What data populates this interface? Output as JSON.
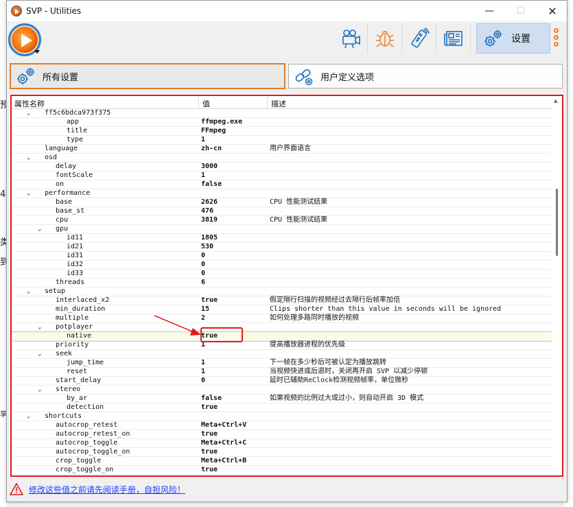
{
  "window": {
    "title": "SVP - Utilities"
  },
  "toolbar": {
    "settings_label": "设置"
  },
  "tabs": {
    "all_settings": "所有设置",
    "user_options": "用户定义选项"
  },
  "grid": {
    "headers": {
      "name": "属性名称",
      "value": "值",
      "description": "描述"
    },
    "rows": [
      {
        "name": "ff5c6bdca973f375",
        "value": "",
        "desc": ""
      },
      {
        "name": "app",
        "value": "ffmpeg.exe",
        "desc": ""
      },
      {
        "name": "title",
        "value": "FFmpeg",
        "desc": ""
      },
      {
        "name": "type",
        "value": "1",
        "desc": ""
      },
      {
        "name": "language",
        "value": "zh-cn",
        "desc": "用户界面语言"
      },
      {
        "name": "osd",
        "value": "",
        "desc": ""
      },
      {
        "name": "delay",
        "value": "3000",
        "desc": ""
      },
      {
        "name": "fontScale",
        "value": "1",
        "desc": ""
      },
      {
        "name": "on",
        "value": "false",
        "desc": ""
      },
      {
        "name": "performance",
        "value": "",
        "desc": ""
      },
      {
        "name": "base",
        "value": "2626",
        "desc": "CPU 性能测试结果"
      },
      {
        "name": "base_st",
        "value": "476",
        "desc": ""
      },
      {
        "name": "cpu",
        "value": "3819",
        "desc": "CPU 性能测试结果"
      },
      {
        "name": "gpu",
        "value": "",
        "desc": ""
      },
      {
        "name": "id11",
        "value": "1805",
        "desc": ""
      },
      {
        "name": "id21",
        "value": "530",
        "desc": ""
      },
      {
        "name": "id31",
        "value": "0",
        "desc": ""
      },
      {
        "name": "id32",
        "value": "0",
        "desc": ""
      },
      {
        "name": "id33",
        "value": "0",
        "desc": ""
      },
      {
        "name": "threads",
        "value": "6",
        "desc": ""
      },
      {
        "name": "setup",
        "value": "",
        "desc": ""
      },
      {
        "name": "interlaced_x2",
        "value": "true",
        "desc": "假定隔行扫描的视频经过去隔行后帧率加倍"
      },
      {
        "name": "min_duration",
        "value": "15",
        "desc": "Clips shorter than this value in seconds will be ignored"
      },
      {
        "name": "multiple",
        "value": "2",
        "desc": "如何处理多路同时播放的视频"
      },
      {
        "name": "potplayer",
        "value": "",
        "desc": ""
      },
      {
        "name": "native",
        "value": "true",
        "desc": ""
      },
      {
        "name": "priority",
        "value": "1",
        "desc": "提高播放器进程的优先级"
      },
      {
        "name": "seek",
        "value": "",
        "desc": ""
      },
      {
        "name": "jump_time",
        "value": "1",
        "desc": "下一帧在多少秒后可被认定为播放跳转"
      },
      {
        "name": "reset",
        "value": "1",
        "desc": "当视频快进或后退时，关闭再开启 SVP 以减少停顿"
      },
      {
        "name": "start_delay",
        "value": "0",
        "desc": "延时已辅助ReClock检测视频帧率，单位微秒"
      },
      {
        "name": "stereo",
        "value": "",
        "desc": ""
      },
      {
        "name": "by_ar",
        "value": "false",
        "desc": "如果视频的比例过大或过小，则自动开启 3D 模式"
      },
      {
        "name": "detection",
        "value": "true",
        "desc": ""
      },
      {
        "name": "shortcuts",
        "value": "",
        "desc": ""
      },
      {
        "name": "autocrop_retest",
        "value": "Meta+Ctrl+V",
        "desc": ""
      },
      {
        "name": "autocrop_retest_on",
        "value": "true",
        "desc": ""
      },
      {
        "name": "autocrop_toggle",
        "value": "Meta+Ctrl+C",
        "desc": ""
      },
      {
        "name": "autocrop_toggle_on",
        "value": "true",
        "desc": ""
      },
      {
        "name": "crop_toggle",
        "value": "Meta+Ctrl+B",
        "desc": ""
      },
      {
        "name": "crop_toggle_on",
        "value": "true",
        "desc": ""
      }
    ]
  },
  "footer": {
    "warning": "修改这些值之前请先阅读手册，自担风险！"
  },
  "background": {
    "glyphs": [
      "预",
      "4",
      "类",
      "到",
      "享"
    ]
  },
  "colors": {
    "accent_orange": "#e07a28",
    "highlight_red": "#e01a1a",
    "link_blue": "#1a3cff"
  }
}
